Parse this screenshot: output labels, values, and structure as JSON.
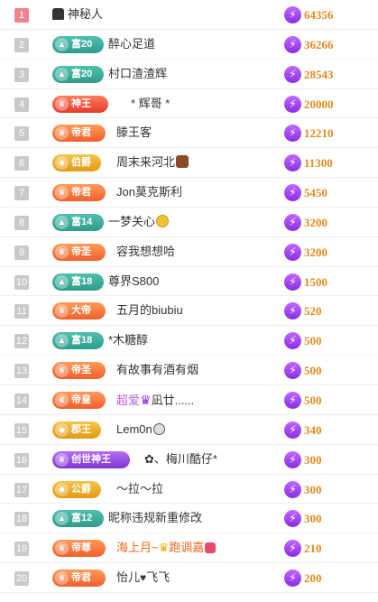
{
  "rows": [
    {
      "rank": "1",
      "badge": "",
      "name": "神秘人",
      "value": "64356"
    },
    {
      "rank": "2",
      "badge": "富20",
      "name": "醉心足道",
      "value": "36266"
    },
    {
      "rank": "3",
      "badge": "富20",
      "name": "村口渣渣辉",
      "value": "28543"
    },
    {
      "rank": "4",
      "badge": "神王",
      "name": "* 辉哥 *",
      "value": "20000"
    },
    {
      "rank": "5",
      "badge": "帝君",
      "name": "滕王客",
      "value": "12210"
    },
    {
      "rank": "6",
      "badge": "伯爵",
      "name": "周末来河北",
      "value": "11300"
    },
    {
      "rank": "7",
      "badge": "帝君",
      "name": "Jon莫克斯利",
      "value": "5450"
    },
    {
      "rank": "8",
      "badge": "富14",
      "name": "一梦关心",
      "value": "3200"
    },
    {
      "rank": "9",
      "badge": "帝圣",
      "name": "容我想想哈",
      "value": "3200"
    },
    {
      "rank": "10",
      "badge": "富18",
      "name": "尊界S800",
      "value": "1500"
    },
    {
      "rank": "11",
      "badge": "大帝",
      "name": "五月的biubiu",
      "value": "520"
    },
    {
      "rank": "12",
      "badge": "富18",
      "name": "*木糖醇",
      "value": "500"
    },
    {
      "rank": "13",
      "badge": "帝圣",
      "name": "有故事有酒有烟",
      "value": "500"
    },
    {
      "rank": "14",
      "badge": "帝皇",
      "name": "超爱",
      "name2": "凪廿......",
      "value": "500"
    },
    {
      "rank": "15",
      "badge": "郡王",
      "name": "Lem0n",
      "value": "340"
    },
    {
      "rank": "16",
      "badge": "创世神王",
      "name": "✿、梅川酷仔*",
      "value": "300"
    },
    {
      "rank": "17",
      "badge": "公爵",
      "name": "～拉～拉",
      "value": "300"
    },
    {
      "rank": "18",
      "badge": "富12",
      "name": "昵称违规新重修改",
      "value": "300"
    },
    {
      "rank": "19",
      "badge": "帝尊",
      "name": "海上月~",
      "name2": "跑调嘉",
      "value": "210"
    },
    {
      "rank": "20",
      "badge": "帝君",
      "name": "怡儿",
      "name2": "飞飞",
      "value": "200"
    }
  ]
}
